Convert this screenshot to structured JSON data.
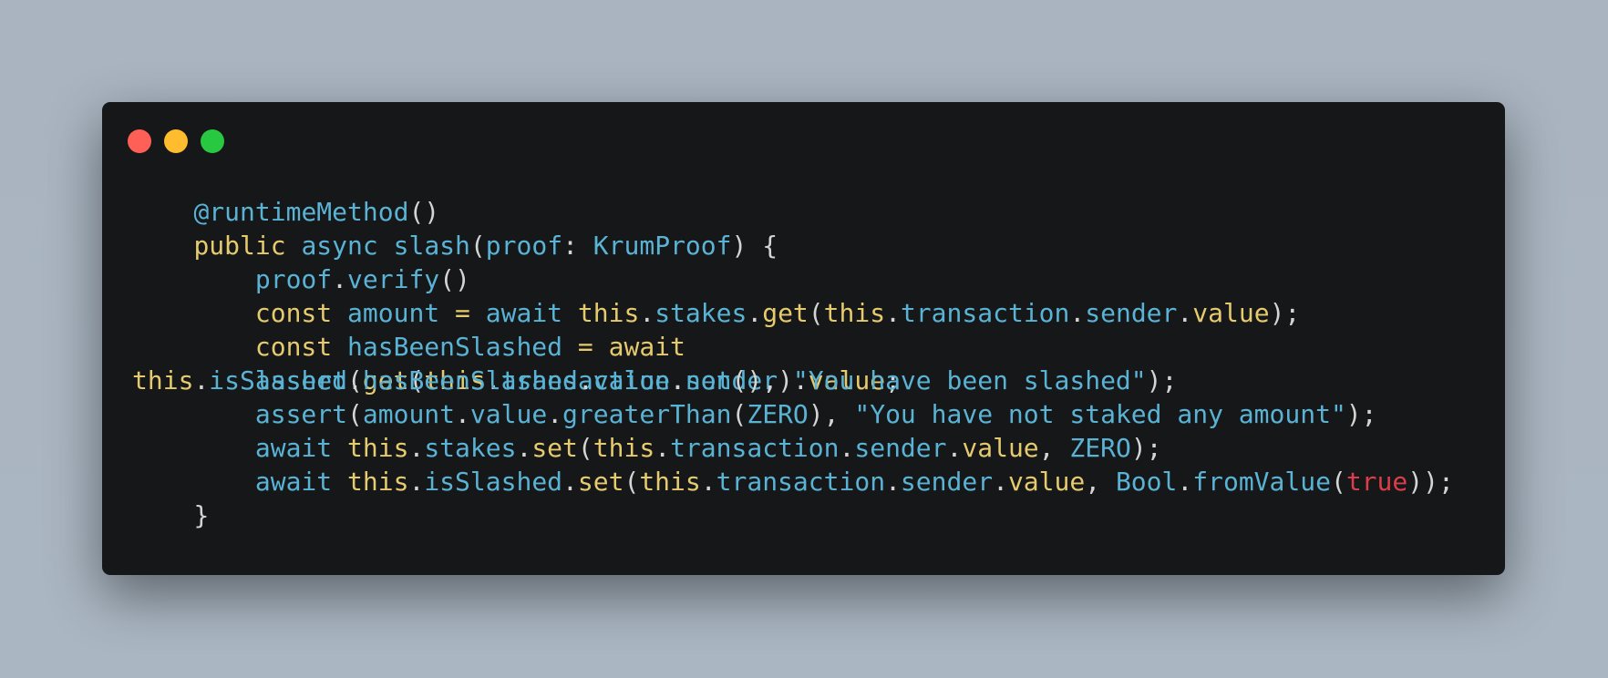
{
  "window": {
    "controls": [
      {
        "name": "close",
        "color": "#fe5f57"
      },
      {
        "name": "minimize",
        "color": "#febc2e"
      },
      {
        "name": "maximize",
        "color": "#28c840"
      }
    ]
  },
  "code": {
    "language": "typescript",
    "colors": {
      "keyword": "#e6ca6e",
      "identifier": "#5ab3d5",
      "punctuation": "#d4d4d4",
      "literal": "#dc3d4a",
      "background": "#151718"
    },
    "lines": [
      [
        [
          "    ",
          "p"
        ],
        [
          "@runtimeMethod",
          "i"
        ],
        [
          "()",
          "p"
        ]
      ],
      [
        [
          "    ",
          "p"
        ],
        [
          "public",
          "k"
        ],
        [
          " ",
          "p"
        ],
        [
          "async",
          "i"
        ],
        [
          " ",
          "p"
        ],
        [
          "slash",
          "i"
        ],
        [
          "(",
          "p"
        ],
        [
          "proof",
          "i"
        ],
        [
          ": ",
          "p"
        ],
        [
          "KrumProof",
          "i"
        ],
        [
          ") {",
          "p"
        ]
      ],
      [
        [
          "        ",
          "p"
        ],
        [
          "proof",
          "i"
        ],
        [
          ".",
          "p"
        ],
        [
          "verify",
          "i"
        ],
        [
          "()",
          "p"
        ]
      ],
      [
        [
          "        ",
          "p"
        ],
        [
          "const",
          "k"
        ],
        [
          " ",
          "p"
        ],
        [
          "amount",
          "i"
        ],
        [
          " = ",
          "k"
        ],
        [
          "await",
          "i"
        ],
        [
          " ",
          "p"
        ],
        [
          "this",
          "k"
        ],
        [
          ".",
          "p"
        ],
        [
          "stakes",
          "i"
        ],
        [
          ".",
          "p"
        ],
        [
          "get",
          "k"
        ],
        [
          "(",
          "p"
        ],
        [
          "this",
          "k"
        ],
        [
          ".",
          "p"
        ],
        [
          "transaction",
          "i"
        ],
        [
          ".",
          "p"
        ],
        [
          "sender",
          "i"
        ],
        [
          ".",
          "p"
        ],
        [
          "value",
          "k"
        ],
        [
          ");",
          "p"
        ]
      ],
      [
        [
          "        ",
          "p"
        ],
        [
          "const",
          "k"
        ],
        [
          " ",
          "p"
        ],
        [
          "hasBeenSlashed",
          "i"
        ],
        [
          " = ",
          "k"
        ],
        [
          "await",
          "k"
        ]
      ],
      [
        [
          "this",
          "k"
        ],
        [
          ".",
          "p"
        ],
        [
          "isSlashed",
          "i"
        ],
        [
          ".",
          "p"
        ],
        [
          "get",
          "k"
        ],
        [
          "(",
          "p"
        ],
        [
          "this",
          "k"
        ],
        [
          ".",
          "p"
        ],
        [
          "transaction",
          "i"
        ],
        [
          ".",
          "p"
        ],
        [
          "sender",
          "i"
        ],
        [
          ")",
          "p"
        ],
        [
          ".",
          "p"
        ],
        [
          "value",
          "k"
        ],
        [
          ";",
          "p"
        ]
      ],
      [
        [
          "        ",
          "p"
        ],
        [
          "assert",
          "i"
        ],
        [
          "(",
          "p"
        ],
        [
          "amount",
          "i"
        ],
        [
          ".",
          "p"
        ],
        [
          "value",
          "i"
        ],
        [
          ".",
          "p"
        ],
        [
          "greaterThan",
          "i"
        ],
        [
          "(",
          "p"
        ],
        [
          "ZERO",
          "i"
        ],
        [
          "), ",
          "p"
        ],
        [
          "\"You have not staked any amount\"",
          "i"
        ],
        [
          ");",
          "p"
        ]
      ],
      [
        [
          "        ",
          "p"
        ],
        [
          "await",
          "i"
        ],
        [
          " ",
          "p"
        ],
        [
          "this",
          "k"
        ],
        [
          ".",
          "p"
        ],
        [
          "stakes",
          "i"
        ],
        [
          ".",
          "p"
        ],
        [
          "set",
          "k"
        ],
        [
          "(",
          "p"
        ],
        [
          "this",
          "k"
        ],
        [
          ".",
          "p"
        ],
        [
          "transaction",
          "i"
        ],
        [
          ".",
          "p"
        ],
        [
          "sender",
          "i"
        ],
        [
          ".",
          "p"
        ],
        [
          "value",
          "k"
        ],
        [
          ", ",
          "p"
        ],
        [
          "ZERO",
          "i"
        ],
        [
          ");",
          "p"
        ]
      ],
      [
        [
          "        ",
          "p"
        ],
        [
          "await",
          "i"
        ],
        [
          " ",
          "p"
        ],
        [
          "this",
          "k"
        ],
        [
          ".",
          "p"
        ],
        [
          "isSlashed",
          "i"
        ],
        [
          ".",
          "p"
        ],
        [
          "set",
          "k"
        ],
        [
          "(",
          "p"
        ],
        [
          "this",
          "k"
        ],
        [
          ".",
          "p"
        ],
        [
          "transaction",
          "i"
        ],
        [
          ".",
          "p"
        ],
        [
          "sender",
          "i"
        ],
        [
          ".",
          "p"
        ],
        [
          "value",
          "k"
        ],
        [
          ", ",
          "p"
        ],
        [
          "Bool",
          "i"
        ],
        [
          ".",
          "p"
        ],
        [
          "fromValue",
          "i"
        ],
        [
          "(",
          "p"
        ],
        [
          "true",
          "r"
        ],
        [
          "));",
          "p"
        ]
      ],
      [
        [
          "    ",
          "p"
        ],
        [
          "}",
          "p"
        ]
      ]
    ],
    "overlay_line_index": 5,
    "overlay": [
      [
        "        ",
        "p"
      ],
      [
        "assert",
        "i"
      ],
      [
        "(",
        "p"
      ],
      [
        "hasBeenSlashed",
        "i"
      ],
      [
        ".",
        "p"
      ],
      [
        "value",
        "i"
      ],
      [
        ".",
        "p"
      ],
      [
        "not",
        "i"
      ],
      [
        "(), ",
        "p"
      ],
      [
        "\"You have been slashed\"",
        "i"
      ],
      [
        ");",
        "p"
      ]
    ]
  }
}
